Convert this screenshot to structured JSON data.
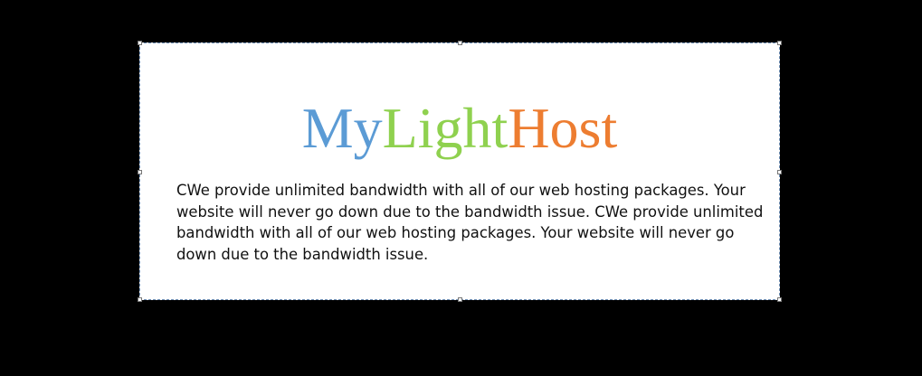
{
  "logo": {
    "part1": "My",
    "part2": "Light",
    "part3": "Host",
    "colors": {
      "part1": "#5b9bd5",
      "part2": "#8fd14f",
      "part3": "#ed7d31"
    }
  },
  "body": {
    "text": "CWe provide unlimited bandwidth with all of our web hosting packages. Your website will never go down due to the bandwidth issue. CWe provide unlimited bandwidth with all of our web hosting packages. Your website will never go down due to the bandwidth issue."
  }
}
